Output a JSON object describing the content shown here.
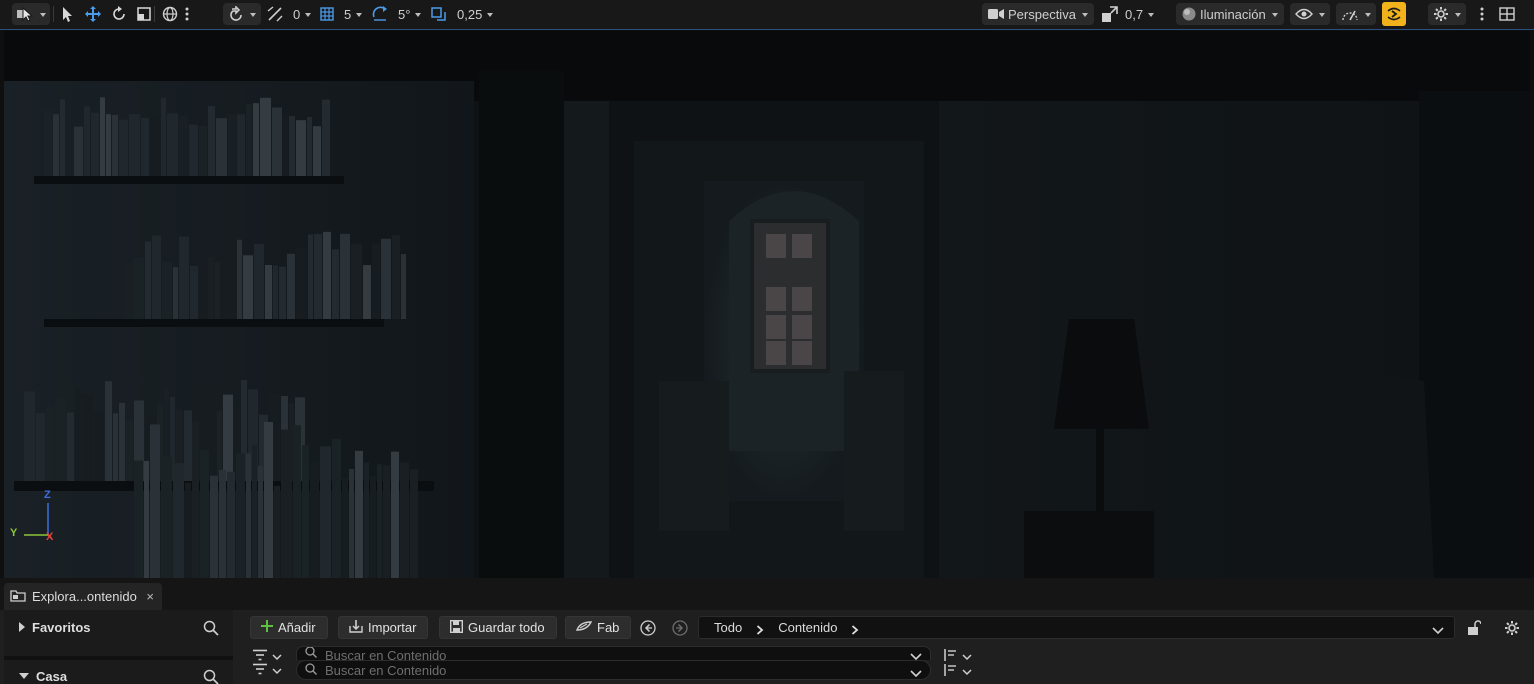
{
  "toolbar": {
    "translate_snap_value": "0",
    "grid_snap_value": "5",
    "rotation_snap_value": "5°",
    "scale_snap_value": "0,25",
    "view_mode_label": "Perspectiva",
    "camera_speed_value": "0,7",
    "lighting_mode_label": "Iluminación",
    "accent_color": "#f2b21b"
  },
  "viewport": {
    "axis_labels": {
      "z": "Z",
      "y": "Y",
      "x": "X"
    },
    "axis_colors": {
      "z": "#3d6fe0",
      "y": "#8cc63a",
      "x": "#e0443a"
    }
  },
  "content_browser": {
    "tab_label": "Explora...ontenido",
    "tab_close": "×",
    "tree": {
      "favorites_label": "Favoritos",
      "project_label": "Casa"
    },
    "buttons": {
      "add_label": "Añadir",
      "import_label": "Importar",
      "save_all_label": "Guardar todo",
      "fab_label": "Fab"
    },
    "breadcrumb": [
      "Todo",
      "Contenido"
    ],
    "search_placeholder": "Buscar en Contenido"
  }
}
